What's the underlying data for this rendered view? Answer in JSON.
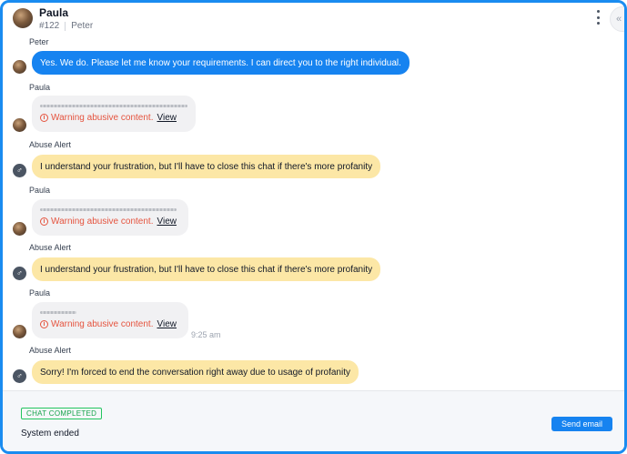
{
  "header": {
    "name": "Paula",
    "ticket_id": "#122",
    "agent": "Peter",
    "more_icon": "kebab-vertical-icon",
    "collapse_icon": "chevrons-left-icon"
  },
  "messages": [
    {
      "sender": "Peter",
      "type": "agent",
      "text": "Yes. We do. Please let me know your requirements. I can direct you to the right individual."
    },
    {
      "sender": "Paula",
      "type": "customer",
      "warning": "Warning abusive content.",
      "link": "View"
    },
    {
      "sender": "Abuse Alert",
      "type": "alert",
      "text": "I understand your frustration, but I'll have to close this chat if there's more profanity"
    },
    {
      "sender": "Paula",
      "type": "customer",
      "warning": "Warning abusive content.",
      "link": "View"
    },
    {
      "sender": "Abuse Alert",
      "type": "alert",
      "text": "I understand your frustration, but I'll have to close this chat if there's more profanity"
    },
    {
      "sender": "Paula",
      "type": "customer",
      "warning": "Warning abusive content.",
      "link": "View",
      "time": "9:25 am"
    },
    {
      "sender": "Abuse Alert",
      "type": "alert",
      "text": "Sorry! I'm forced to end the conversation right away due to usage of profanity"
    }
  ],
  "footer": {
    "status": "CHAT COMPLETED",
    "system_text": "System ended",
    "send_email_label": "Send email"
  },
  "colors": {
    "accent": "#1683f0",
    "alert_bubble": "#fce7a6",
    "warning": "#e5543f",
    "status_green": "#16a34a"
  }
}
